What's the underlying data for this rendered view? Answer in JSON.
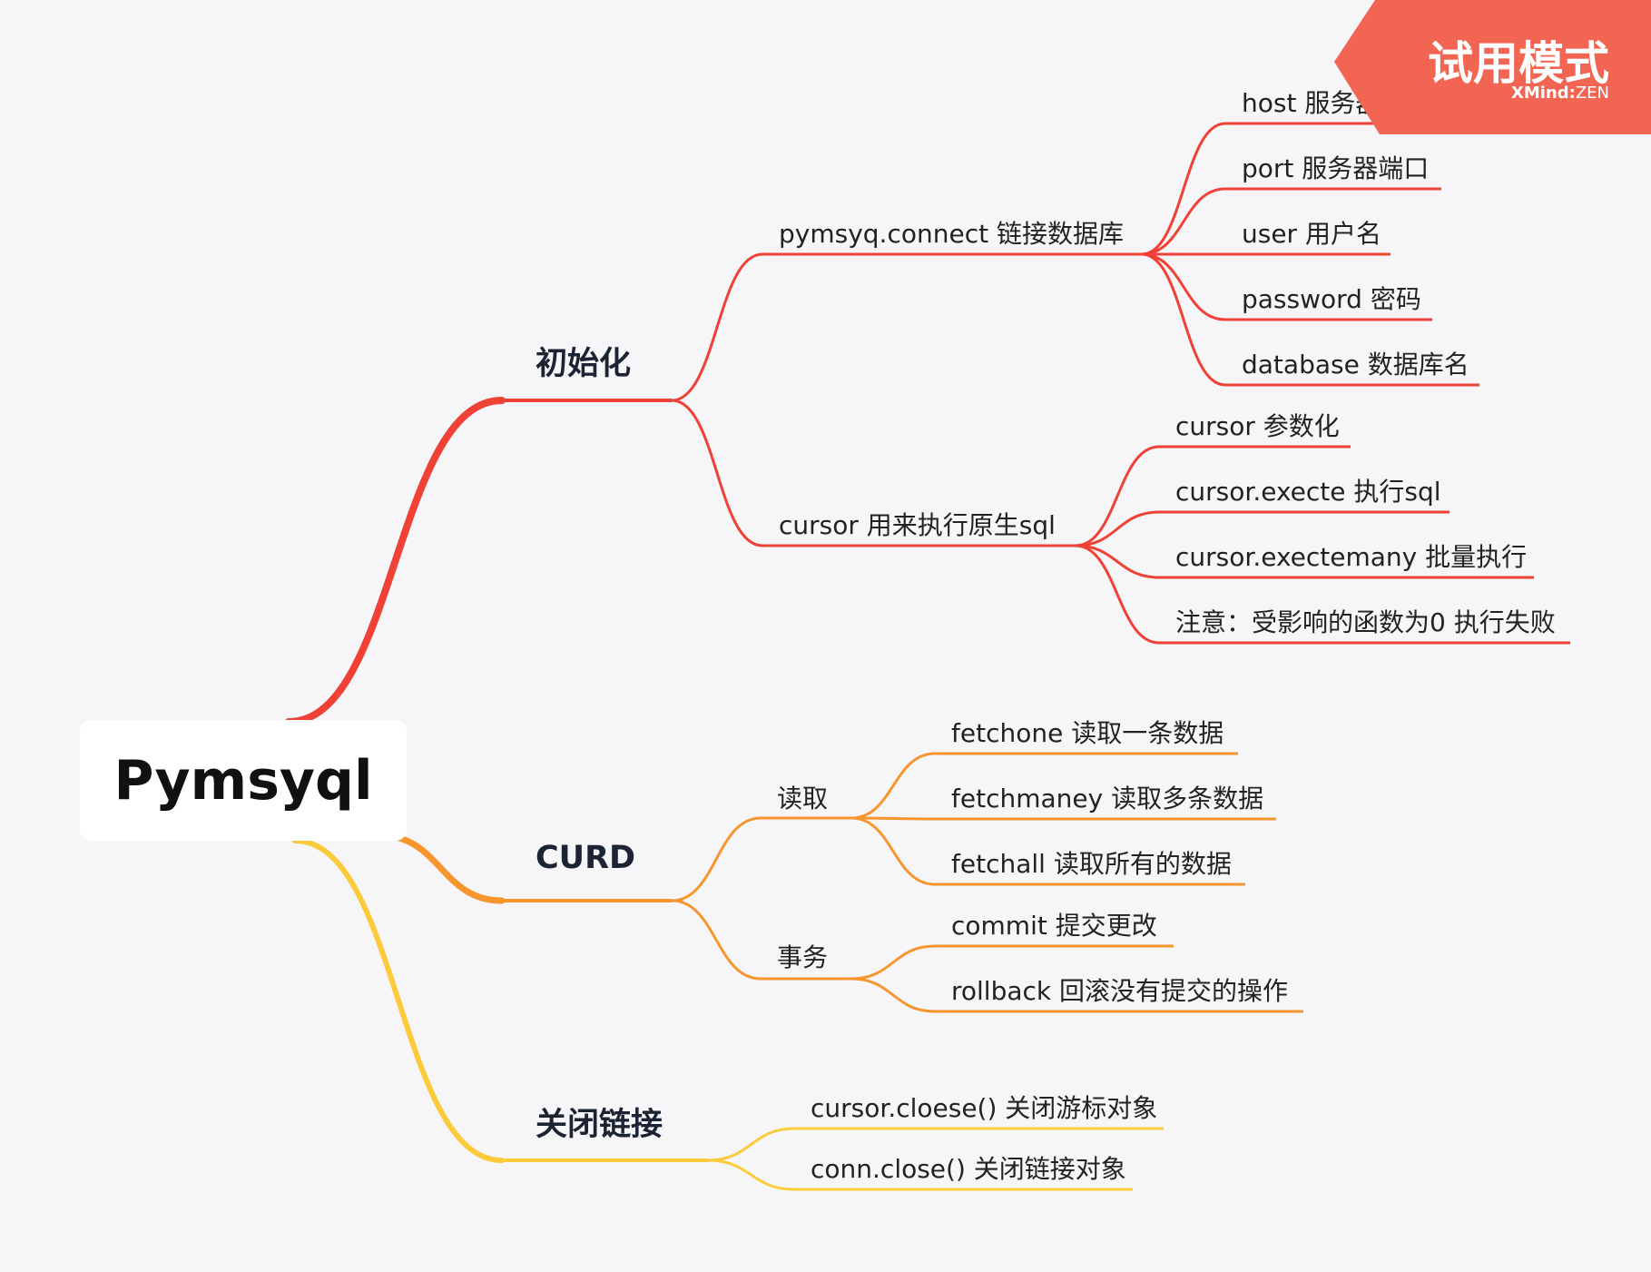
{
  "colors": {
    "background": "#f6f6f9",
    "branch_init": "#ef4136",
    "branch_curd": "#f7962f",
    "branch_close": "#fccb3c",
    "watermark": "#f26552"
  },
  "watermark": {
    "title": "试用模式",
    "brand": "XMind",
    "separator": ":",
    "edition": "ZEN"
  },
  "mindmap": {
    "root": "Pymsyql",
    "branches": [
      {
        "label": "初始化",
        "color": "#ef4136",
        "children": [
          {
            "label": "pymsyq.connect 链接数据库",
            "children": [
              "host 服务器地址",
              "port 服务器端口",
              "user 用户名",
              "password 密码",
              "database 数据库名"
            ]
          },
          {
            "label": "cursor 用来执行原生sql",
            "children": [
              "cursor 参数化",
              "cursor.execte 执行sql",
              "cursor.exectemany 批量执行",
              "注意：受影响的函数为0 执行失败"
            ]
          }
        ]
      },
      {
        "label": "CURD",
        "color": "#f7962f",
        "children": [
          {
            "label": "读取",
            "children": [
              "fetchone 读取一条数据",
              "fetchmaney 读取多条数据",
              "fetchall 读取所有的数据"
            ]
          },
          {
            "label": "事务",
            "children": [
              "commit 提交更改",
              "rollback 回滚没有提交的操作"
            ]
          }
        ]
      },
      {
        "label": "关闭链接",
        "color": "#fccb3c",
        "children": [
          "cursor.cloese() 关闭游标对象",
          "conn.close() 关闭链接对象"
        ]
      }
    ]
  }
}
